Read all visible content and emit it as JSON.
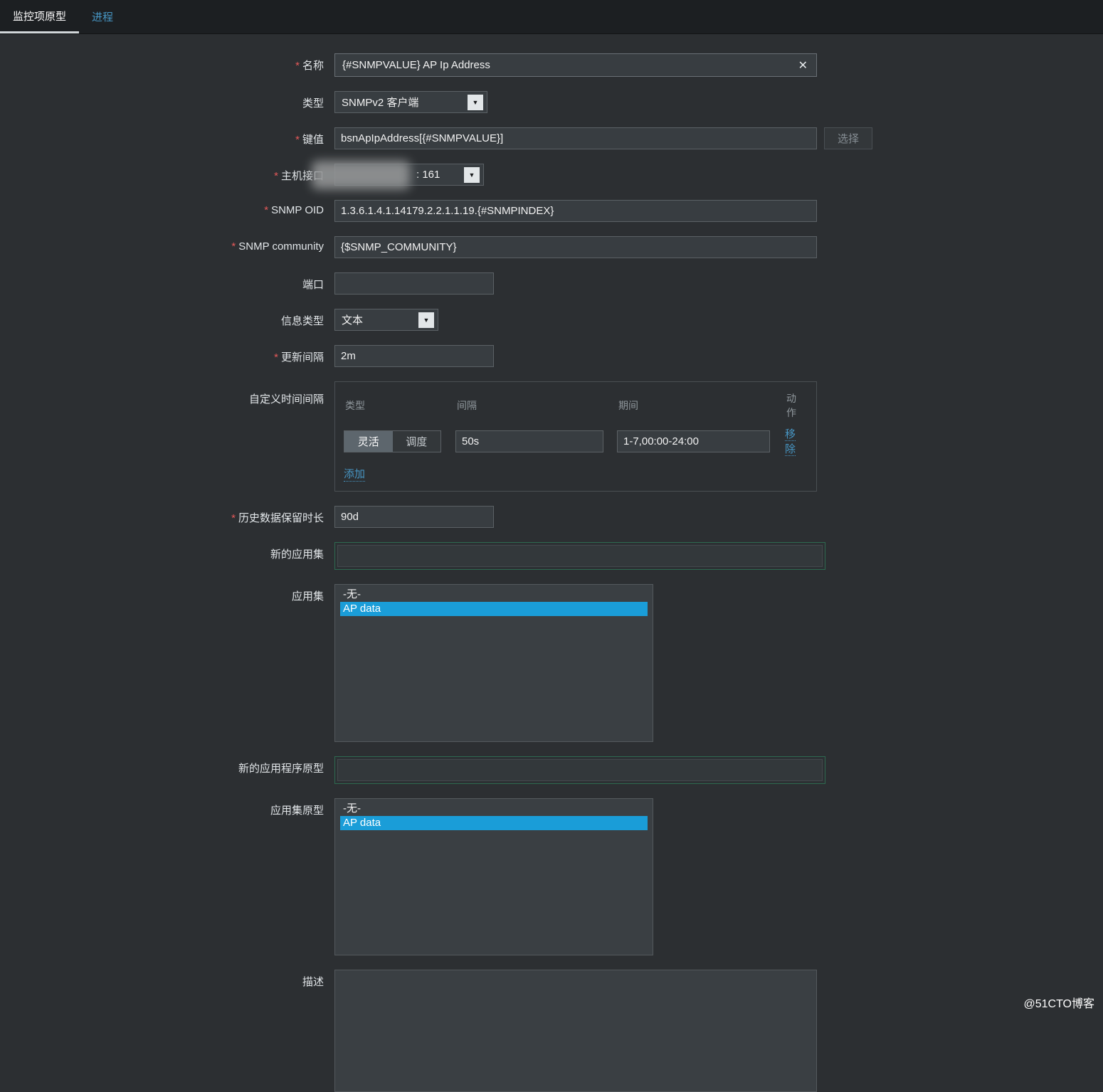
{
  "colors": {
    "accent-blue": "#1a9dd8",
    "link-blue": "#4796c4",
    "required-red": "#e45959",
    "green-border": "#2e6a50"
  },
  "icons": {
    "dropdown": "▼",
    "clear": "✕"
  },
  "tabs": {
    "item_prototype": "监控项原型",
    "process": "进程"
  },
  "form": {
    "name": {
      "label": "名称",
      "value": "{#SNMPVALUE} AP Ip Address"
    },
    "type": {
      "label": "类型",
      "value": "SNMPv2 客户端"
    },
    "key": {
      "label": "键值",
      "value": "bsnApIpAddress[{#SNMPVALUE}]",
      "select_button": "选择"
    },
    "host_interface": {
      "label": "主机接口",
      "value": ": 161"
    },
    "snmp_oid": {
      "label": "SNMP OID",
      "value": "1.3.6.1.4.1.14179.2.2.1.1.19.{#SNMPINDEX}"
    },
    "snmp_community": {
      "label": "SNMP community",
      "value": "{$SNMP_COMMUNITY}"
    },
    "port": {
      "label": "端口",
      "value": ""
    },
    "info_type": {
      "label": "信息类型",
      "value": "文本"
    },
    "update_interval": {
      "label": "更新间隔",
      "value": "2m"
    },
    "custom_intervals": {
      "label": "自定义时间间隔",
      "headers": {
        "type": "类型",
        "interval": "间隔",
        "period": "期间",
        "action": "动作"
      },
      "row": {
        "flexible": "灵活",
        "scheduling": "调度",
        "interval": "50s",
        "period": "1-7,00:00-24:00",
        "remove": "移除"
      },
      "add": "添加"
    },
    "history": {
      "label": "历史数据保留时长",
      "value": "90d"
    },
    "new_application": {
      "label": "新的应用集",
      "value": ""
    },
    "applications": {
      "label": "应用集",
      "options": [
        "-无-",
        "AP data"
      ],
      "selected": "AP data"
    },
    "new_app_prototype": {
      "label": "新的应用程序原型",
      "value": ""
    },
    "app_prototypes": {
      "label": "应用集原型",
      "options": [
        "-无-",
        "AP data"
      ],
      "selected": "AP data"
    },
    "description": {
      "label": "描述",
      "value": ""
    }
  },
  "watermark": "@51CTO博客"
}
